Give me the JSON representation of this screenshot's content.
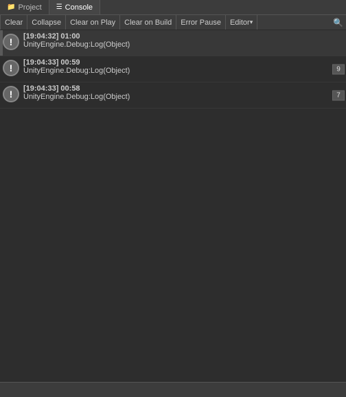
{
  "tabs": [
    {
      "id": "project",
      "label": "Project",
      "icon": "📁",
      "active": false
    },
    {
      "id": "console",
      "label": "Console",
      "icon": "☰",
      "active": true
    }
  ],
  "toolbar": {
    "clear_label": "Clear",
    "collapse_label": "Collapse",
    "clear_on_play_label": "Clear on Play",
    "clear_on_build_label": "Clear on Build",
    "error_pause_label": "Error Pause",
    "editor_label": "Editor"
  },
  "log_entries": [
    {
      "id": 1,
      "timestamp": "[19:04:32] 01:00",
      "message": "UnityEngine.Debug:Log(Object)",
      "type": "error",
      "count": null
    },
    {
      "id": 2,
      "timestamp": "[19:04:33] 00:59",
      "message": "UnityEngine.Debug:Log(Object)",
      "type": "error",
      "count": "9"
    },
    {
      "id": 3,
      "timestamp": "[19:04:33] 00:58",
      "message": "UnityEngine.Debug:Log(Object)",
      "type": "error",
      "count": "7"
    }
  ],
  "search": {
    "placeholder": "Search"
  }
}
